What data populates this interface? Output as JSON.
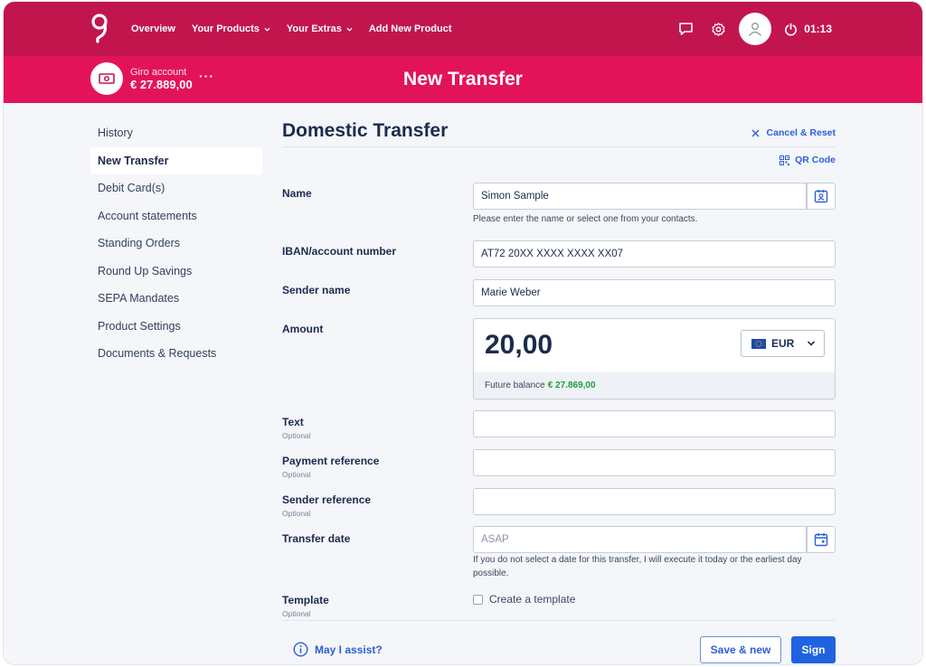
{
  "colors": {
    "brand": "#c2154e",
    "brand_light": "#e3135a",
    "accent": "#1f63e0",
    "positive": "#1f9d3b"
  },
  "header": {
    "logo_icon": "bank-logo-icon",
    "nav": [
      {
        "label": "Overview",
        "has_dropdown": false
      },
      {
        "label": "Your Products",
        "has_dropdown": true
      },
      {
        "label": "Your Extras",
        "has_dropdown": true
      },
      {
        "label": "Add New Product",
        "has_dropdown": false
      }
    ],
    "icons": [
      "chat-icon",
      "gear-icon",
      "user-icon",
      "power-icon"
    ],
    "session_timer": "01:13"
  },
  "account_bar": {
    "account_name": "Giro account",
    "balance": "€ 27.889,00",
    "more": "···",
    "page_title": "New Transfer"
  },
  "sidebar": {
    "items": [
      {
        "label": "History",
        "active": false
      },
      {
        "label": "New Transfer",
        "active": true
      },
      {
        "label": "Debit Card(s)",
        "active": false
      },
      {
        "label": "Account statements",
        "active": false
      },
      {
        "label": "Standing Orders",
        "active": false
      },
      {
        "label": "Round Up Savings",
        "active": false
      },
      {
        "label": "SEPA Mandates",
        "active": false
      },
      {
        "label": "Product Settings",
        "active": false
      },
      {
        "label": "Documents & Requests",
        "active": false
      }
    ]
  },
  "form": {
    "title": "Domestic Transfer",
    "cancel_label": "Cancel & Reset",
    "qr_label": "QR Code",
    "name": {
      "label": "Name",
      "value": "Simon Sample",
      "hint": "Please enter the name or select one from your contacts."
    },
    "iban": {
      "label": "IBAN/account number",
      "value": "AT72 20XX XXXX XXXX XX07"
    },
    "sender_name": {
      "label": "Sender name",
      "value": "Marie Weber"
    },
    "amount": {
      "label": "Amount",
      "value": "20,00",
      "currency": "EUR",
      "future_label": "Future balance",
      "future_value": "€ 27.869,00"
    },
    "text": {
      "label": "Text",
      "optional": "Optional",
      "value": ""
    },
    "payment_reference": {
      "label": "Payment reference",
      "optional": "Optional",
      "value": ""
    },
    "sender_reference": {
      "label": "Sender reference",
      "optional": "Optional",
      "value": ""
    },
    "transfer_date": {
      "label": "Transfer date",
      "placeholder": "ASAP",
      "hint": "If you do not select a date for this transfer, I will execute it today or the earliest day possible."
    },
    "template": {
      "label": "Template",
      "optional": "Optional",
      "checkbox_label": "Create a template",
      "checked": false
    }
  },
  "footer": {
    "assist_label": "May I assist?",
    "save_new_label": "Save & new",
    "sign_label": "Sign"
  }
}
